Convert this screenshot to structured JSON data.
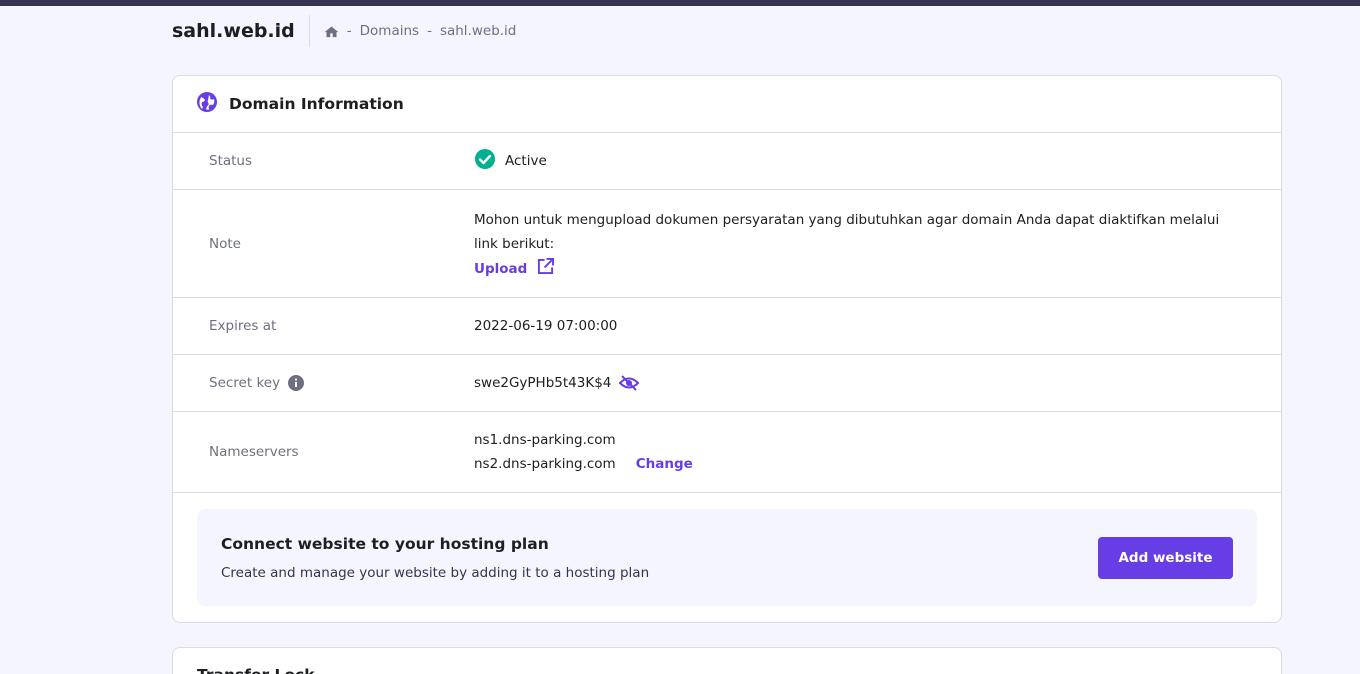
{
  "header": {
    "site_title": "sahl.web.id",
    "breadcrumb": {
      "home_icon": "home-icon",
      "sep": "-",
      "domains": "Domains",
      "current": "sahl.web.id"
    }
  },
  "domain_info": {
    "title": "Domain Information",
    "icon": "globe-icon",
    "status": {
      "label": "Status",
      "value": "Active",
      "icon": "check-circle-icon",
      "color": "#00b090"
    },
    "note": {
      "label": "Note",
      "text": "Mohon untuk mengupload dokumen persyaratan yang dibutuhkan agar domain Anda dapat diaktifkan melalui link berikut:",
      "link_label": "Upload",
      "link_icon": "external-link-icon"
    },
    "expires": {
      "label": "Expires at",
      "value": "2022-06-19 07:00:00"
    },
    "secret_key": {
      "label": "Secret key",
      "info_icon": "info-icon",
      "value": "swe2GyPHb5t43K$4",
      "toggle_icon": "eye-slash-icon"
    },
    "nameservers": {
      "label": "Nameservers",
      "ns1": "ns1.dns-parking.com",
      "ns2": "ns2.dns-parking.com",
      "change_label": "Change"
    }
  },
  "promo": {
    "title": "Connect website to your hosting plan",
    "description": "Create and manage your website by adding it to a hosting plan",
    "button_label": "Add website"
  },
  "next_card": {
    "title": "Transfer Lock"
  },
  "colors": {
    "accent": "#673de6",
    "success": "#00b090",
    "background": "#f4f5ff"
  }
}
